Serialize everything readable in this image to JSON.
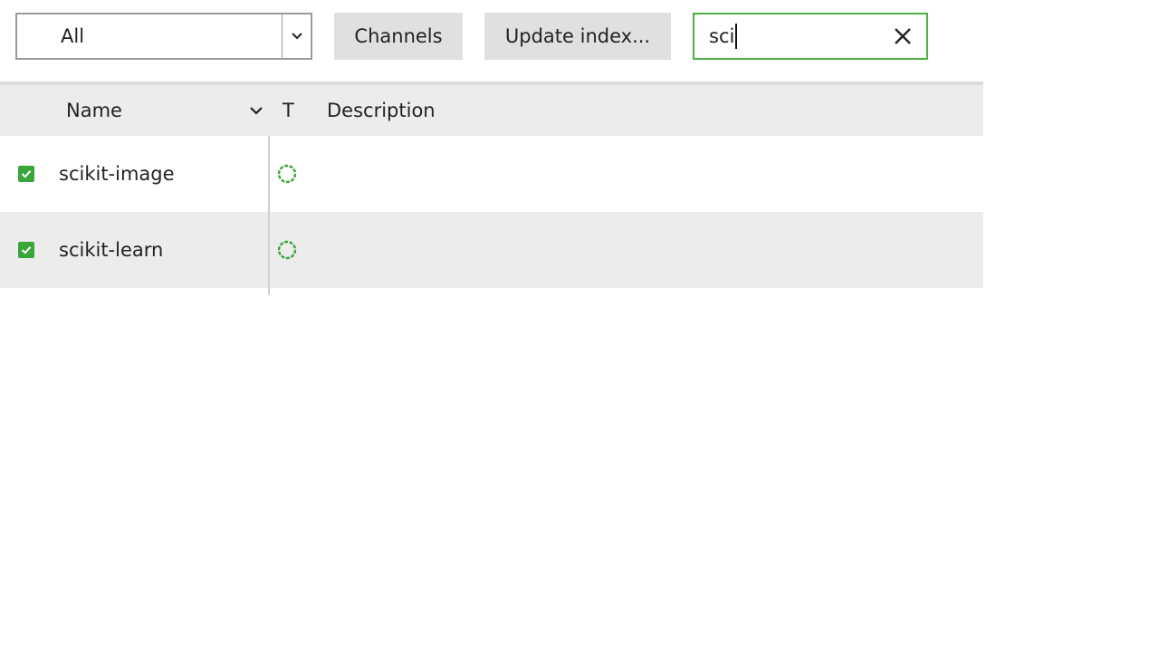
{
  "toolbar": {
    "filter": {
      "selected": "All"
    },
    "channels_label": "Channels",
    "update_index_label": "Update index...",
    "search": {
      "value": "sci"
    }
  },
  "table": {
    "columns": {
      "name": "Name",
      "type": "T",
      "description": "Description"
    },
    "rows": [
      {
        "name": "scikit-image",
        "checked": true,
        "status": "installing",
        "description": ""
      },
      {
        "name": "scikit-learn",
        "checked": true,
        "status": "installing",
        "description": ""
      }
    ]
  },
  "colors": {
    "accent": "#3aa63a",
    "search_border": "#4caf3f",
    "header_bg": "#ececec"
  }
}
